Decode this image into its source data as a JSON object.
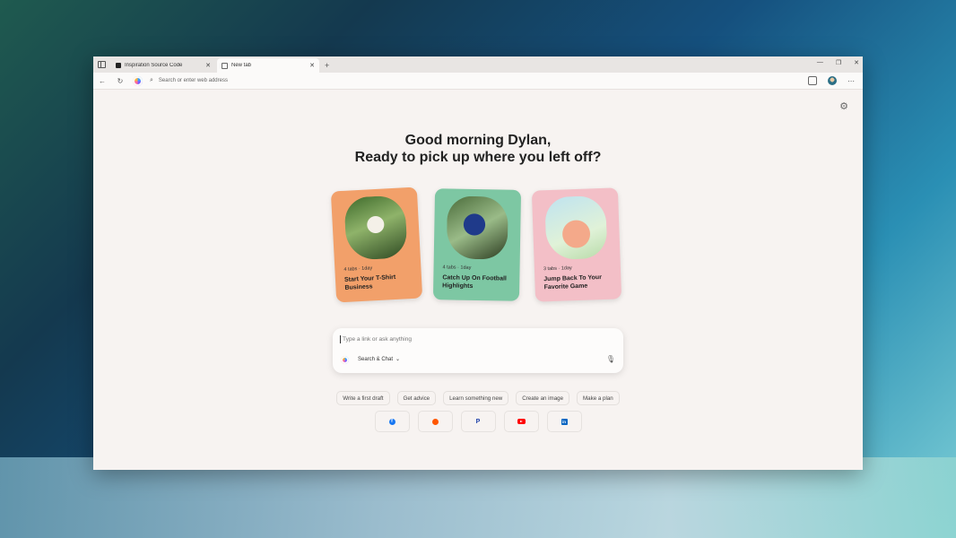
{
  "tabs": [
    {
      "title": "Inspiration Source Code",
      "active": false
    },
    {
      "title": "New tab",
      "active": true
    }
  ],
  "address_bar": {
    "placeholder": "Search or enter web address"
  },
  "greeting": {
    "line1": "Good morning Dylan,",
    "line2": "Ready to pick up where you left off?"
  },
  "cards": [
    {
      "meta": "4 tabs · 1day",
      "label": "Start Your T-Shirt Business",
      "color": "#f2a06a"
    },
    {
      "meta": "4 tabs · 1day",
      "label": "Catch Up On Football Highlights",
      "color": "#7dc7a3"
    },
    {
      "meta": "3 tabs · 1day",
      "label": "Jump Back To Your Favorite Game",
      "color": "#f3bfc7"
    }
  ],
  "chat": {
    "placeholder": "Type a link or ask anything",
    "mode": "Search & Chat"
  },
  "suggestions": [
    "Write a first draft",
    "Get advice",
    "Learn something new",
    "Create an image",
    "Make a plan"
  ],
  "shortcuts": [
    {
      "icon": "facebook-icon",
      "glyph": "f"
    },
    {
      "icon": "reddit-icon",
      "glyph": ""
    },
    {
      "icon": "paypal-icon",
      "glyph": "P"
    },
    {
      "icon": "youtube-icon",
      "glyph": ""
    },
    {
      "icon": "linkedin-icon",
      "glyph": "in"
    }
  ]
}
